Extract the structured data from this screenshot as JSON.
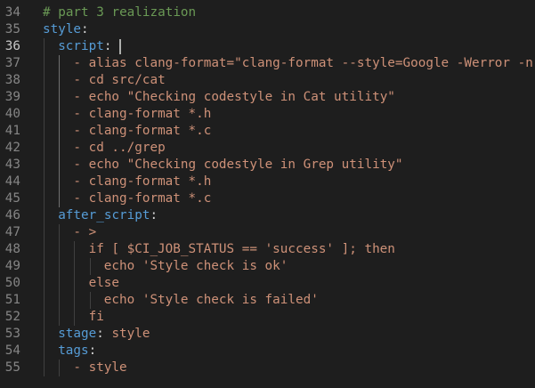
{
  "editor": {
    "first_line_number": 34,
    "active_line_index": 2,
    "lines": [
      {
        "indent": 0,
        "tokens": [
          {
            "t": "# part 3 realization",
            "c": "comment"
          }
        ]
      },
      {
        "indent": 0,
        "tokens": [
          {
            "t": "style",
            "c": "key"
          },
          {
            "t": ":",
            "c": "punc"
          }
        ]
      },
      {
        "indent": 1,
        "tokens": [
          {
            "t": "script",
            "c": "key"
          },
          {
            "t": ": ",
            "c": "punc"
          }
        ]
      },
      {
        "indent": 2,
        "tokens": [
          {
            "t": "- alias clang-format=\"clang-format --style=Google -Werror -n\"",
            "c": "str"
          }
        ]
      },
      {
        "indent": 2,
        "tokens": [
          {
            "t": "- cd src/cat",
            "c": "str"
          }
        ]
      },
      {
        "indent": 2,
        "tokens": [
          {
            "t": "- echo \"Checking codestyle in Cat utility\"",
            "c": "str"
          }
        ]
      },
      {
        "indent": 2,
        "tokens": [
          {
            "t": "- clang-format *.h",
            "c": "str"
          }
        ]
      },
      {
        "indent": 2,
        "tokens": [
          {
            "t": "- clang-format *.c",
            "c": "str"
          }
        ]
      },
      {
        "indent": 2,
        "tokens": [
          {
            "t": "- cd ../grep",
            "c": "str"
          }
        ]
      },
      {
        "indent": 2,
        "tokens": [
          {
            "t": "- echo \"Checking codestyle in Grep utility\"",
            "c": "str"
          }
        ]
      },
      {
        "indent": 2,
        "tokens": [
          {
            "t": "- clang-format *.h",
            "c": "str"
          }
        ]
      },
      {
        "indent": 2,
        "tokens": [
          {
            "t": "- clang-format *.c",
            "c": "str"
          }
        ]
      },
      {
        "indent": 1,
        "tokens": [
          {
            "t": "after_script",
            "c": "key"
          },
          {
            "t": ":",
            "c": "punc"
          }
        ]
      },
      {
        "indent": 2,
        "tokens": [
          {
            "t": "- >",
            "c": "str"
          }
        ]
      },
      {
        "indent": 3,
        "tokens": [
          {
            "t": "if [ $CI_JOB_STATUS == 'success' ]; then",
            "c": "str"
          }
        ]
      },
      {
        "indent": 4,
        "tokens": [
          {
            "t": "echo 'Style check is ok'",
            "c": "str"
          }
        ]
      },
      {
        "indent": 3,
        "tokens": [
          {
            "t": "else",
            "c": "str"
          }
        ]
      },
      {
        "indent": 4,
        "tokens": [
          {
            "t": "echo 'Style check is failed'",
            "c": "str"
          }
        ]
      },
      {
        "indent": 3,
        "tokens": [
          {
            "t": "fi",
            "c": "str"
          }
        ]
      },
      {
        "indent": 1,
        "tokens": [
          {
            "t": "stage",
            "c": "key"
          },
          {
            "t": ": ",
            "c": "punc"
          },
          {
            "t": "style",
            "c": "str"
          }
        ]
      },
      {
        "indent": 1,
        "tokens": [
          {
            "t": "tags",
            "c": "key"
          },
          {
            "t": ":",
            "c": "punc"
          }
        ]
      },
      {
        "indent": 2,
        "tokens": [
          {
            "t": "- style",
            "c": "str"
          }
        ]
      }
    ]
  },
  "colors": {
    "background": "#1e1e1e",
    "comment": "#6a9955",
    "key": "#569cd6",
    "string": "#ce9178",
    "line_number": "#858585"
  }
}
